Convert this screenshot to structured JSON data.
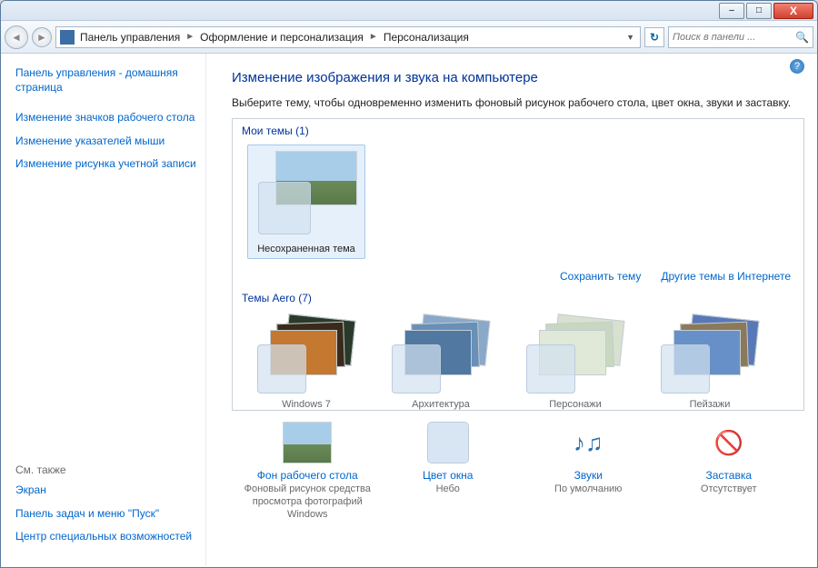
{
  "window": {
    "minimize": "–",
    "maximize": "□",
    "close": "X"
  },
  "nav": {
    "back": "◄",
    "forward": "►",
    "refresh": "↻"
  },
  "breadcrumb": {
    "root": "Панель управления",
    "level2": "Оформление и персонализация",
    "level3": "Персонализация",
    "sep": "►",
    "dropdown": "▼"
  },
  "search": {
    "placeholder": "Поиск в панели ...",
    "icon": "🔍"
  },
  "sidebar": {
    "home": "Панель управления - домашняя страница",
    "links": [
      "Изменение значков рабочего стола",
      "Изменение указателей мыши",
      "Изменение рисунка учетной записи"
    ],
    "see_also": "См. также",
    "footer_links": [
      "Экран",
      "Панель задач и меню \"Пуск\"",
      "Центр специальных возможностей"
    ]
  },
  "main": {
    "help": "?",
    "title": "Изменение изображения и звука на компьютере",
    "description": "Выберите тему, чтобы одновременно изменить фоновый рисунок рабочего стола, цвет окна, звуки и заставку.",
    "my_themes_label": "Мои темы (1)",
    "my_theme_item": "Несохраненная тема",
    "save_theme": "Сохранить тему",
    "more_online": "Другие темы в Интернете",
    "aero_label": "Темы Aero (7)",
    "aero_items": [
      "Windows 7",
      "Архитектура",
      "Персонажи",
      "Пейзажи"
    ]
  },
  "bottom": {
    "bg": {
      "title": "Фон рабочего стола",
      "desc": "Фоновый рисунок средства просмотра фотографий Windows"
    },
    "color": {
      "title": "Цвет окна",
      "desc": "Небо"
    },
    "sounds": {
      "title": "Звуки",
      "desc": "По умолчанию",
      "icon": "♪♫"
    },
    "saver": {
      "title": "Заставка",
      "desc": "Отсутствует",
      "icon": "🚫"
    }
  }
}
